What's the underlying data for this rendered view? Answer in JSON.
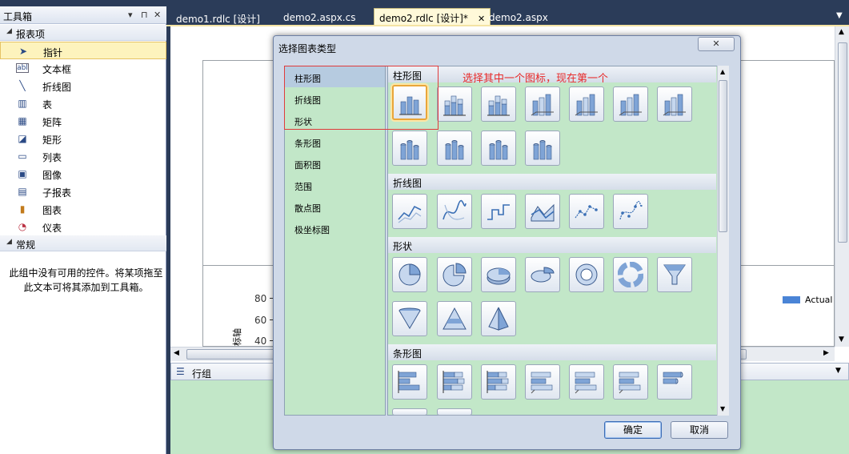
{
  "toolbox": {
    "title": "工具箱",
    "pin_glyph": "▾ ⊓ ✕",
    "group_report": "报表项",
    "items": [
      "指针",
      "文本框",
      "折线图",
      "表",
      "矩阵",
      "矩形",
      "列表",
      "图像",
      "子报表",
      "图表",
      "仪表"
    ],
    "group_general": "常规",
    "empty_note": "此组中没有可用的控件。将某项拖至此文本可将其添加到工具箱。"
  },
  "tabs": [
    {
      "label": "demo1.rdlc [设计]"
    },
    {
      "label": "demo2.aspx.cs"
    },
    {
      "label": "demo2.rdlc [设计]*",
      "active": true
    },
    {
      "label": "demo2.aspx"
    }
  ],
  "designer": {
    "y_ticks": [
      "80",
      "60",
      "40"
    ],
    "y_label": "标轴",
    "legend": "Actual",
    "group_bar": "行组"
  },
  "dialog": {
    "title": "选择图表类型",
    "close": "✕",
    "categories": [
      "柱形图",
      "折线图",
      "形状",
      "条形图",
      "面积图",
      "范围",
      "散点图",
      "极坐标图"
    ],
    "sections": [
      "柱形图",
      "折线图",
      "形状",
      "条形图"
    ],
    "annotation": "选择其中一个图标，现在第一个",
    "ok": "确定",
    "cancel": "取消"
  },
  "icons": [
    "pointer-icon",
    "textbox-icon",
    "line-icon",
    "table-icon",
    "matrix-icon",
    "rectangle-icon",
    "list-icon",
    "image-icon",
    "subreport-icon",
    "chart-icon",
    "gauge-icon"
  ]
}
